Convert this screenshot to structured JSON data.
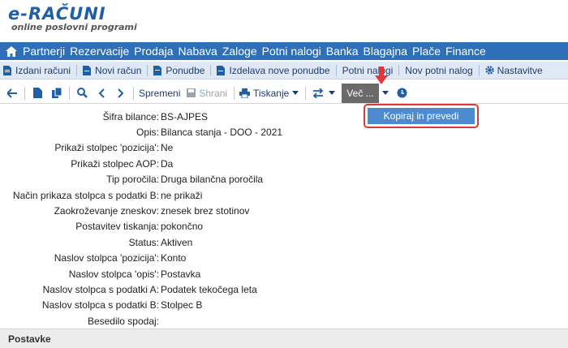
{
  "logo": {
    "brand": "e-RAČUNI",
    "tagline": "online poslovni programi"
  },
  "main_nav": {
    "items": [
      "Partnerji",
      "Rezervacije",
      "Prodaja",
      "Nabava",
      "Zaloge",
      "Potni nalogi",
      "Banka",
      "Blagajna",
      "Plače",
      "Finance"
    ]
  },
  "sub_nav": {
    "items": [
      "Izdani računi",
      "Novi račun",
      "Ponudbe",
      "Izdelava nove ponudbe",
      "Potni nalogi",
      "Nov potni nalog",
      "Nastavitve"
    ]
  },
  "toolbar": {
    "edit_label": "Spremeni",
    "save_label": "Shrani",
    "print_label": "Tiskanje",
    "more_label": "Več ..."
  },
  "dropdown": {
    "item": "Kopiraj in prevedi"
  },
  "form": {
    "rows": [
      {
        "label": "Šifra bilance:",
        "value": "BS-AJPES"
      },
      {
        "label": "Opis:",
        "value": "Bilanca stanja - DOO - 2021"
      },
      {
        "label": "Prikaži stolpec 'pozicija':",
        "value": "Ne"
      },
      {
        "label": "Prikaži stolpec AOP:",
        "value": "Da"
      },
      {
        "label": "Tip poročila:",
        "value": "Druga bilančna poročila"
      },
      {
        "label": "Način prikaza stolpca s podatki B:",
        "value": "ne prikaži"
      },
      {
        "label": "Zaokroževanje zneskov:",
        "value": "znesek brez stotinov"
      },
      {
        "label": "Postavitev tiskanja:",
        "value": "pokončno"
      },
      {
        "label": "Status:",
        "value": "Aktiven"
      },
      {
        "label": "Naslov stolpca 'pozicija':",
        "value": "Konto"
      },
      {
        "label": "Naslov stolpca 'opis':",
        "value": "Postavka"
      },
      {
        "label": "Naslov stolpca s podatki A:",
        "value": "Podatek tekočega leta"
      },
      {
        "label": "Naslov stolpca s podatki B:",
        "value": "Stolpec B"
      },
      {
        "label": "Besedilo spodaj:",
        "value": ""
      }
    ]
  },
  "section": {
    "title": "Postavke"
  },
  "colors": {
    "nav_bg": "#2f6fb8",
    "subnav_bg": "#dfe9f5",
    "accent": "#4d8ad0",
    "highlight": "#e0383a"
  }
}
